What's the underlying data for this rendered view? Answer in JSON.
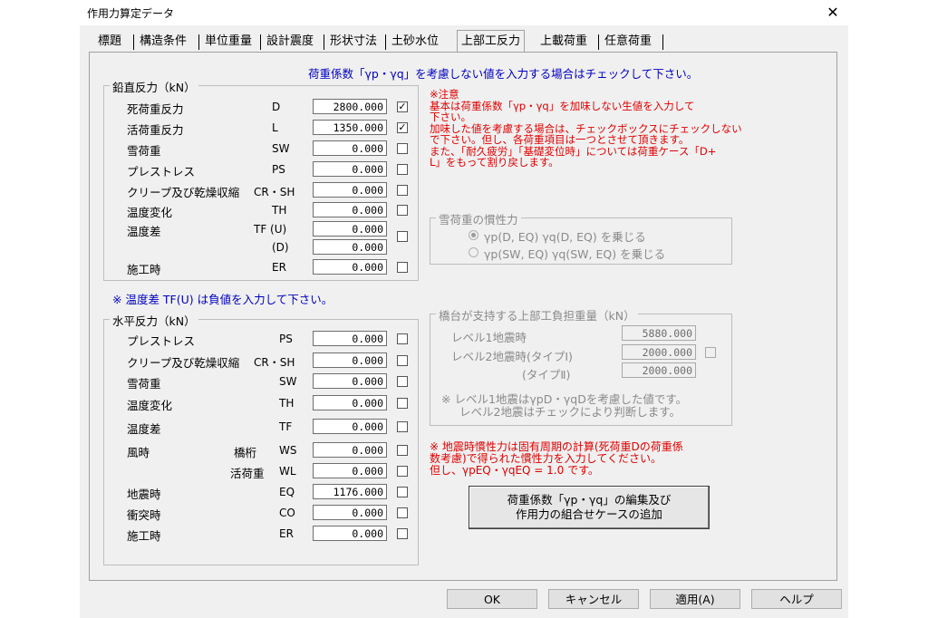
{
  "window": {
    "title": "作用力算定データ",
    "close": "✕"
  },
  "tabs": [
    "標題",
    "構造条件",
    "単位重量",
    "設計震度",
    "形状寸法",
    "土砂水位",
    "上部工反力",
    "上載荷重",
    "任意荷重"
  ],
  "header_note": "荷重係数「γp・γq」を考慮しない値を入力する場合はチェックして下さい。",
  "vertical": {
    "title": "鉛直反力（kN）",
    "rows": [
      {
        "label": "死荷重反力",
        "code": "D",
        "value": "2800.000",
        "checked": true,
        "check_mark": "✓"
      },
      {
        "label": "活荷重反力",
        "code": "L",
        "value": "1350.000",
        "checked": true,
        "check_mark": "✓"
      },
      {
        "label": "雪荷重",
        "code": "SW",
        "value": "0.000",
        "checked": false
      },
      {
        "label": "プレストレス",
        "code": "PS",
        "value": "0.000",
        "checked": false
      },
      {
        "label": "クリープ及び乾燥収縮",
        "code": "CR・SH",
        "value": "0.000",
        "checked": false
      },
      {
        "label": "温度変化",
        "code": "TH",
        "value": "0.000",
        "checked": false
      },
      {
        "label": "温度差",
        "code": "TF (U)",
        "value": "0.000",
        "checked": false
      },
      {
        "label": "",
        "code": "(D)",
        "value": "0.000",
        "checked": false
      },
      {
        "label": "施工時",
        "code": "ER",
        "value": "0.000",
        "checked": false
      }
    ]
  },
  "temp_note": "※ 温度差 TF(U) は負値を入力して下さい。",
  "horizontal": {
    "title": "水平反力（kN）",
    "rows": [
      {
        "label": "プレストレス",
        "sub": "",
        "code": "PS",
        "value": "0.000"
      },
      {
        "label": "クリープ及び乾燥収縮",
        "sub": "",
        "code": "CR・SH",
        "value": "0.000"
      },
      {
        "label": "雪荷重",
        "sub": "",
        "code": "SW",
        "value": "0.000"
      },
      {
        "label": "温度変化",
        "sub": "",
        "code": "TH",
        "value": "0.000"
      },
      {
        "label": "温度差",
        "sub": "",
        "code": "TF",
        "value": "0.000"
      },
      {
        "label": "風時",
        "sub": "橋桁",
        "code": "WS",
        "value": "0.000"
      },
      {
        "label": "",
        "sub": "活荷重",
        "code": "WL",
        "value": "0.000"
      },
      {
        "label": "地震時",
        "sub": "",
        "code": "EQ",
        "value": "1176.000"
      },
      {
        "label": "衝突時",
        "sub": "",
        "code": "CO",
        "value": "0.000"
      },
      {
        "label": "施工時",
        "sub": "",
        "code": "ER",
        "value": "0.000"
      }
    ]
  },
  "caution": {
    "lines": [
      "※注意",
      "基本は荷重係数「γp・γq」を加味しない生値を入力して",
      "下さい。",
      "加味した値を考慮する場合は、チェックボックスにチェックしない",
      "で下さい。但し、各荷重項目は一つとさせて頂きます。",
      "また、「耐久疲労」「基礎変位時」については荷重ケース「D+",
      "L」をもって割り戻します。"
    ]
  },
  "snow": {
    "title": "雪荷重の慣性力",
    "options": [
      "γp(D, EQ) γq(D, EQ) を乗じる",
      "γp(SW, EQ) γq(SW, EQ) を乗じる"
    ],
    "selected": 0
  },
  "bearing": {
    "title": "橋台が支持する上部工負担重量（kN）",
    "l1_label": "レベル1地震時",
    "l1_value": "5880.000",
    "l2_label": "レベル2地震時(タイプⅠ)",
    "l2a_value": "2000.000",
    "l2b_label": "(タイプⅡ)",
    "l2b_value": "2000.000",
    "note1": "※ レベル1地震はγpD・γqDを考慮した値です。",
    "note2": "レベル2地震はチェックにより判断します。"
  },
  "eq_note": {
    "lines": [
      "※ 地震時慣性力は固有周期の計算(死荷重Dの荷重係",
      "数考慮)で得られた慣性力を入力してください。",
      "但し、γpEQ・γqEQ = 1.0 です。"
    ]
  },
  "edit_button": {
    "line1": "荷重係数「γp・γq」の編集及び",
    "line2": "作用力の組合せケースの追加"
  },
  "buttons": {
    "ok": "OK",
    "cancel": "キャンセル",
    "apply": "適用(A)",
    "help": "ヘルプ"
  }
}
